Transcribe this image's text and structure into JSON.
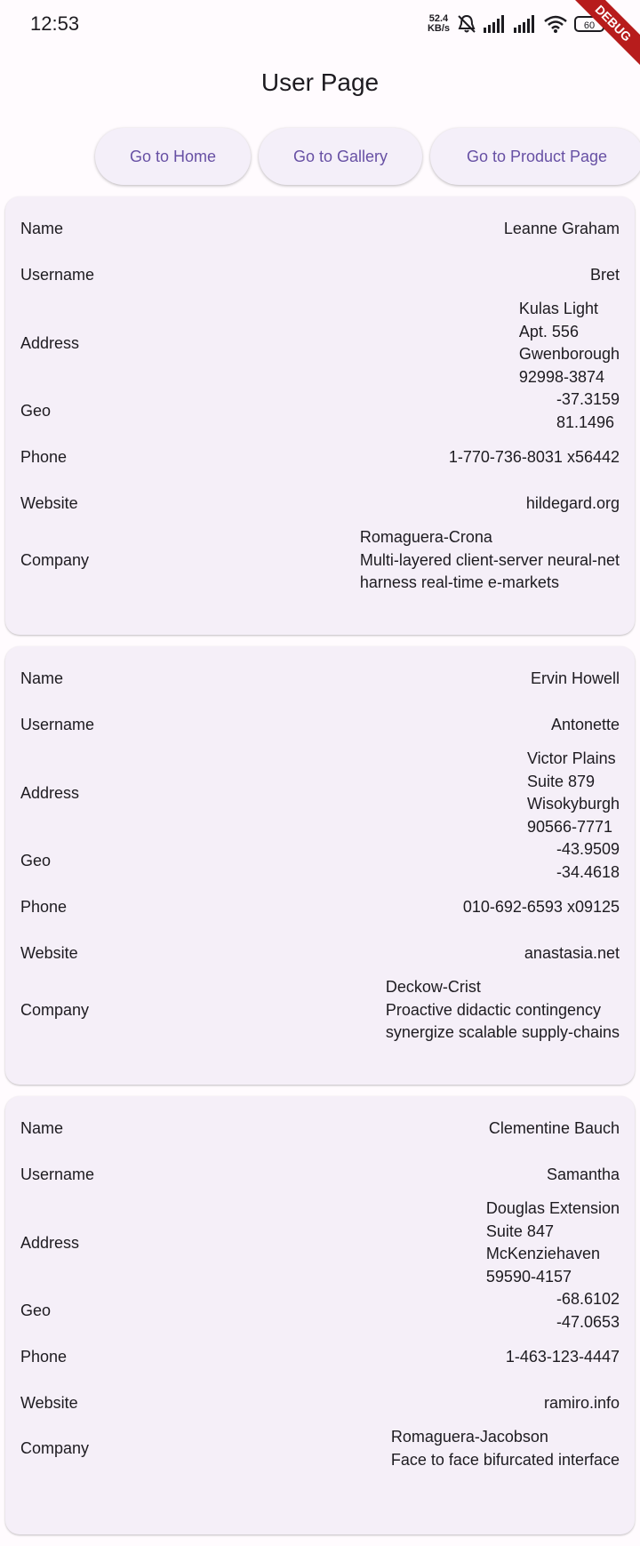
{
  "status_bar": {
    "time": "12:53",
    "net_speed_value": "52.4",
    "net_speed_unit": "KB/s",
    "battery": "60",
    "icons": [
      "mute-icon",
      "signal-icon",
      "signal-icon",
      "wifi-icon",
      "battery-icon"
    ]
  },
  "debug_banner": "DEBUG",
  "app_bar": {
    "title": "User Page"
  },
  "nav": {
    "home": "Go to Home",
    "gallery": "Go to Gallery",
    "product": "Go to Product Page"
  },
  "colors": {
    "accent": "#6750a4",
    "card_bg": "#f5eff8",
    "page_bg": "#fffbfe"
  },
  "labels": {
    "name": "Name",
    "username": "Username",
    "address": "Address",
    "geo": "Geo",
    "phone": "Phone",
    "website": "Website",
    "company": "Company"
  },
  "users": [
    {
      "name": "Leanne Graham",
      "username": "Bret",
      "address": [
        "Kulas Light",
        "Apt. 556",
        "Gwenborough",
        "92998-3874"
      ],
      "geo": [
        "-37.3159",
        "81.1496"
      ],
      "phone": "1-770-736-8031 x56442",
      "website": "hildegard.org",
      "company": [
        "Romaguera-Crona",
        "Multi-layered client-server neural-net",
        "harness real-time e-markets"
      ]
    },
    {
      "name": "Ervin Howell",
      "username": "Antonette",
      "address": [
        "Victor Plains",
        "Suite 879",
        "Wisokyburgh",
        "90566-7771"
      ],
      "geo": [
        "-43.9509",
        "-34.4618"
      ],
      "phone": "010-692-6593 x09125",
      "website": "anastasia.net",
      "company": [
        "Deckow-Crist",
        "Proactive didactic contingency",
        "synergize scalable supply-chains"
      ]
    },
    {
      "name": "Clementine Bauch",
      "username": "Samantha",
      "address": [
        "Douglas Extension",
        "Suite 847",
        "McKenziehaven",
        "59590-4157"
      ],
      "geo": [
        "-68.6102",
        "-47.0653"
      ],
      "phone": "1-463-123-4447",
      "website": "ramiro.info",
      "company": [
        "Romaguera-Jacobson",
        "Face to face bifurcated interface"
      ]
    }
  ]
}
